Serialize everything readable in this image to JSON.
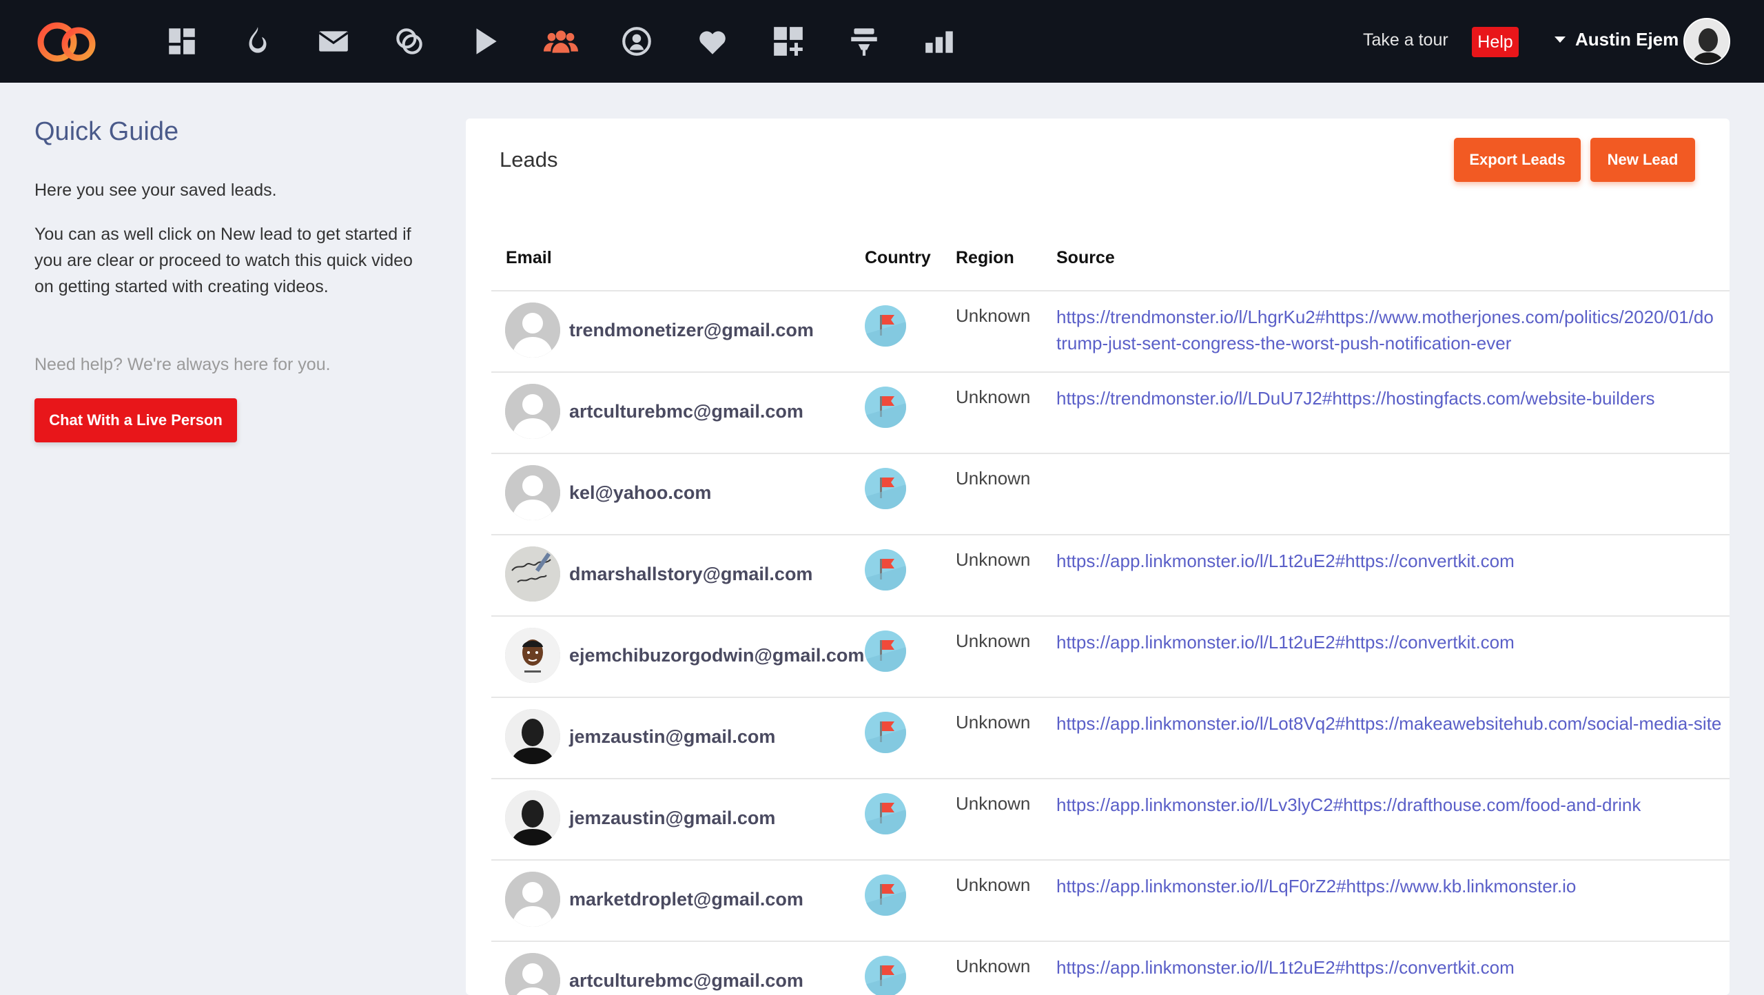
{
  "nav": {
    "icons": [
      "dashboard-icon",
      "flame-icon",
      "mail-icon",
      "link-rings-icon",
      "play-icon",
      "users-icon",
      "support-icon",
      "heart-icon",
      "add-widget-icon",
      "pin-icon",
      "bar-chart-icon"
    ],
    "active_icon": "users-icon",
    "take_tour": "Take a tour",
    "help": "Help",
    "user_name": "Austin Ejem"
  },
  "sidebar": {
    "title": "Quick Guide",
    "p1": "Here you see your saved leads.",
    "p2_lines": [
      "You can as well click on New lead to get started if",
      "you are clear or proceed to watch this quick video",
      "on getting started with creating videos."
    ],
    "need_help": "Need help? We're always here for you.",
    "chat_button": "Chat With a Live Person"
  },
  "leads": {
    "title": "Leads",
    "export_button": "Export Leads",
    "new_button": "New Lead",
    "columns": {
      "email": "Email",
      "country": "Country",
      "region": "Region",
      "source": "Source"
    },
    "rows": [
      {
        "email": "trendmonetizer@gmail.com",
        "avatar": "default",
        "region": "Unknown",
        "source": [
          "https://trendmonster.io/l/LhgrKu2#https://www.motherjones.com/politics/2020/01/do",
          "trump-just-sent-congress-the-worst-push-notification-ever"
        ]
      },
      {
        "email": "artculturebmc@gmail.com",
        "avatar": "default",
        "region": "Unknown",
        "source": [
          "https://trendmonster.io/l/LDuU7J2#https://hostingfacts.com/website-builders"
        ]
      },
      {
        "email": "kel@yahoo.com",
        "avatar": "default",
        "region": "Unknown",
        "source": []
      },
      {
        "email": "dmarshallstory@gmail.com",
        "avatar": "thankyou",
        "region": "Unknown",
        "source": [
          "https://app.linkmonster.io/l/L1t2uE2#https://convertkit.com"
        ]
      },
      {
        "email": "ejemchibuzorgodwin@gmail.com",
        "avatar": "cartoon",
        "region": "Unknown",
        "source": [
          "https://app.linkmonster.io/l/L1t2uE2#https://convertkit.com"
        ]
      },
      {
        "email": "jemzaustin@gmail.com",
        "avatar": "photo",
        "region": "Unknown",
        "source": [
          "https://app.linkmonster.io/l/Lot8Vq2#https://makeawebsitehub.com/social-media-site"
        ]
      },
      {
        "email": "jemzaustin@gmail.com",
        "avatar": "photo",
        "region": "Unknown",
        "source": [
          "https://app.linkmonster.io/l/Lv3lyC2#https://drafthouse.com/food-and-drink"
        ]
      },
      {
        "email": "marketdroplet@gmail.com",
        "avatar": "default",
        "region": "Unknown",
        "source": [
          "https://app.linkmonster.io/l/LqF0rZ2#https://www.kb.linkmonster.io"
        ]
      },
      {
        "email": "artculturebmc@gmail.com",
        "avatar": "default",
        "region": "Unknown",
        "source": [
          "https://app.linkmonster.io/l/L1t2uE2#https://convertkit.com"
        ]
      }
    ]
  },
  "colors": {
    "nav_bg": "#10141c",
    "accent_orange": "#f25a23",
    "help_red": "#e8161a",
    "link": "#5a5fc8",
    "active_nav": "#f06a4a"
  }
}
